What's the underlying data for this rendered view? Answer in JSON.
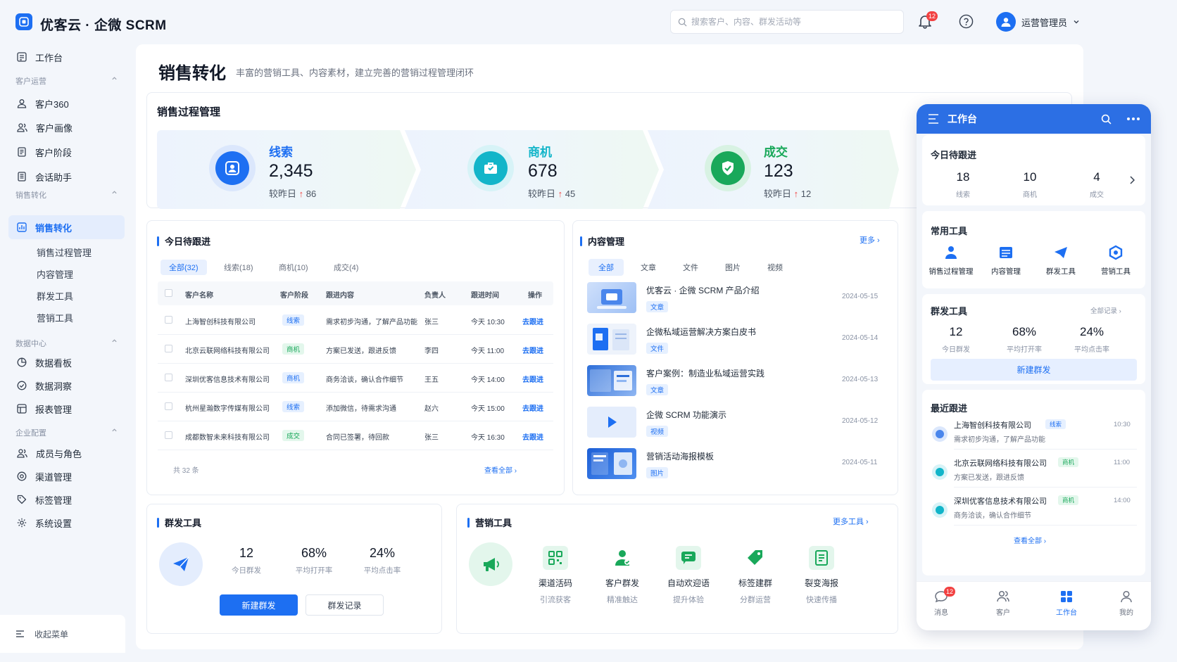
{
  "header": {
    "brand": "优客云 · 企微 SCRM",
    "search_placeholder": "搜索客户、内容、群发活动等",
    "notif_count": "12",
    "user_name": "运营管理员"
  },
  "sidebar": {
    "workbench": "工作台",
    "groups": {
      "customer_ops": "客户运营",
      "sales": "销售转化",
      "data": "数据中心",
      "enterprise": "企业配置"
    },
    "items": {
      "customer360": "客户360",
      "portrait": "客户画像",
      "stage": "客户阶段",
      "assistant": "会话助手",
      "sales_conv": "销售转化",
      "sub_process": "销售过程管理",
      "sub_content": "内容管理",
      "sub_mass": "群发工具",
      "sub_marketing": "营销工具",
      "dashboard": "数据看板",
      "insight": "数据洞察",
      "report": "报表管理",
      "members": "成员与角色",
      "channels": "渠道管理",
      "tags": "标签管理",
      "settings": "系统设置"
    },
    "collapse": "收起菜单"
  },
  "page": {
    "title": "销售转化",
    "subtitle": "丰富的营销工具、内容素材，建立完善的营销过程管理闭环"
  },
  "pipeline": {
    "title": "销售过程管理",
    "stages": [
      {
        "label": "线索",
        "value": "2,345",
        "cmp": "较昨日",
        "delta": "86",
        "color": "#1d6ff2"
      },
      {
        "label": "商机",
        "value": "678",
        "cmp": "较昨日",
        "delta": "45",
        "color": "#12b5c9"
      },
      {
        "label": "成交",
        "value": "123",
        "cmp": "较昨日",
        "delta": "12",
        "color": "#19a85a"
      }
    ]
  },
  "followup": {
    "title": "今日待跟进",
    "tabs": [
      "全部(32)",
      "线索(18)",
      "商机(10)",
      "成交(4)"
    ],
    "columns": [
      "客户名称",
      "客户阶段",
      "跟进内容",
      "负责人",
      "跟进时间",
      "操作"
    ],
    "rows": [
      {
        "name": "上海智创科技有限公司",
        "stage": "线索",
        "content": "需求初步沟通，了解产品功能",
        "owner": "张三",
        "time": "今天 10:30",
        "action": "去跟进"
      },
      {
        "name": "北京云联网络科技有限公司",
        "stage": "商机",
        "content": "方案已发送，跟进反馈",
        "owner": "李四",
        "time": "今天 11:00",
        "action": "去跟进"
      },
      {
        "name": "深圳优客信息技术有限公司",
        "stage": "商机",
        "content": "商务洽谈，确认合作细节",
        "owner": "王五",
        "time": "今天 14:00",
        "action": "去跟进"
      },
      {
        "name": "杭州星瀚数字传媒有限公司",
        "stage": "线索",
        "content": "添加微信，待需求沟通",
        "owner": "赵六",
        "time": "今天 15:00",
        "action": "去跟进"
      },
      {
        "name": "成都数智未来科技有限公司",
        "stage": "成交",
        "content": "合同已签署，待回款",
        "owner": "张三",
        "time": "今天 16:30",
        "action": "去跟进"
      }
    ],
    "total": "共 32 条",
    "view_all": "查看全部"
  },
  "content": {
    "title": "内容管理",
    "more": "更多",
    "tabs": [
      "全部",
      "文章",
      "文件",
      "图片",
      "视频"
    ],
    "items": [
      {
        "title": "优客云 · 企微 SCRM 产品介绍",
        "type": "文章",
        "date": "2024-05-15"
      },
      {
        "title": "企微私域运营解决方案白皮书",
        "type": "文件",
        "date": "2024-05-14"
      },
      {
        "title": "客户案例：制造业私域运营实践",
        "type": "文章",
        "date": "2024-05-13"
      },
      {
        "title": "企微 SCRM 功能演示",
        "type": "视频",
        "date": "2024-05-12"
      },
      {
        "title": "营销活动海报模板",
        "type": "图片",
        "date": "2024-05-11"
      }
    ]
  },
  "mass": {
    "title": "群发工具",
    "stats": [
      {
        "value": "12",
        "label": "今日群发"
      },
      {
        "value": "68%",
        "label": "平均打开率"
      },
      {
        "value": "24%",
        "label": "平均点击率"
      }
    ],
    "new_btn": "新建群发",
    "record_btn": "群发记录"
  },
  "marketing": {
    "title": "营销工具",
    "more": "更多工具",
    "tools": [
      {
        "name": "渠道活码",
        "desc": "引流获客"
      },
      {
        "name": "客户群发",
        "desc": "精准触达"
      },
      {
        "name": "自动欢迎语",
        "desc": "提升体验"
      },
      {
        "name": "标签建群",
        "desc": "分群运营"
      },
      {
        "name": "裂变海报",
        "desc": "快速传播"
      }
    ]
  },
  "phone": {
    "title": "工作台",
    "today": {
      "title": "今日待跟进",
      "stats": [
        {
          "value": "18",
          "label": "线索"
        },
        {
          "value": "10",
          "label": "商机"
        },
        {
          "value": "4",
          "label": "成交"
        }
      ]
    },
    "tools": {
      "title": "常用工具",
      "items": [
        "销售过程管理",
        "内容管理",
        "群发工具",
        "营销工具"
      ]
    },
    "mass": {
      "title": "群发工具",
      "all": "全部记录",
      "stats": [
        {
          "value": "12",
          "label": "今日群发"
        },
        {
          "value": "68%",
          "label": "平均打开率"
        },
        {
          "value": "24%",
          "label": "平均点击率"
        }
      ],
      "btn": "新建群发"
    },
    "recent": {
      "title": "最近跟进",
      "items": [
        {
          "name": "上海智创科技有限公司",
          "tag": "线索",
          "desc": "需求初步沟通，了解产品功能",
          "time": "10:30"
        },
        {
          "name": "北京云联网络科技有限公司",
          "tag": "商机",
          "desc": "方案已发送，跟进反馈",
          "time": "11:00"
        },
        {
          "name": "深圳优客信息技术有限公司",
          "tag": "商机",
          "desc": "商务洽谈，确认合作细节",
          "time": "14:00"
        }
      ],
      "view_all": "查看全部"
    },
    "tabbar": [
      {
        "label": "消息",
        "badge": "12"
      },
      {
        "label": "客户"
      },
      {
        "label": "工作台"
      },
      {
        "label": "我的"
      }
    ]
  },
  "colors": {
    "accent": "#1d6ff2",
    "cyan": "#12b5c9",
    "green": "#19a85a",
    "red": "#f24141"
  }
}
